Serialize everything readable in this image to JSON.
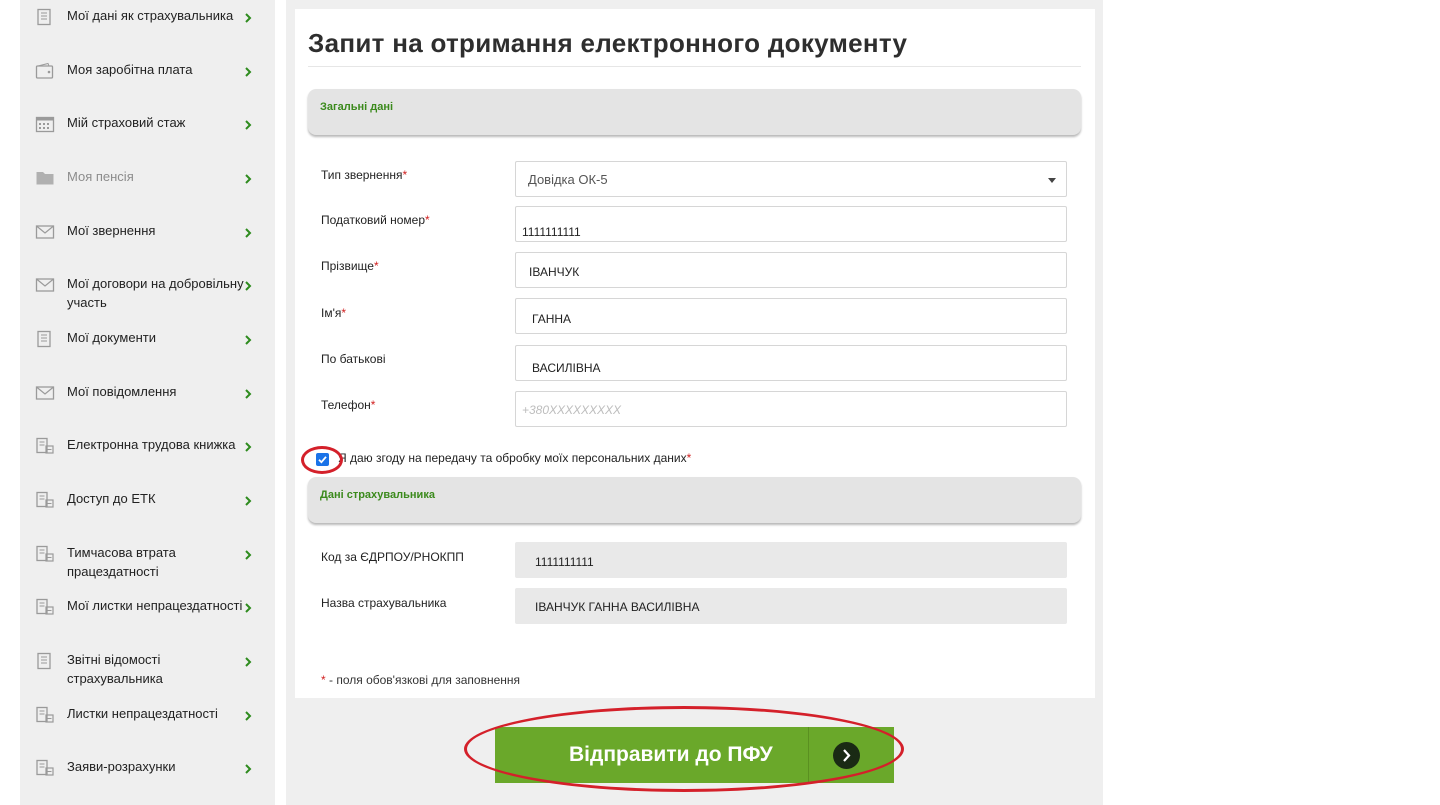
{
  "sidebar": {
    "items": [
      {
        "label": "Мої дані як страхувальника",
        "icon": "document-icon",
        "muted": false
      },
      {
        "label": "Моя заробітна плата",
        "icon": "wallet-icon",
        "muted": false
      },
      {
        "label": "Мій страховий стаж",
        "icon": "calendar-icon",
        "muted": false
      },
      {
        "label": "Моя пенсія",
        "icon": "folder-icon",
        "muted": true
      },
      {
        "label": "Мої звернення",
        "icon": "envelope-icon",
        "muted": false
      },
      {
        "label": "Мої договори на добровільну участь",
        "icon": "envelope-icon",
        "muted": false
      },
      {
        "label": "Мої документи",
        "icon": "document-icon",
        "muted": false
      },
      {
        "label": "Мої повідомлення",
        "icon": "envelope-icon",
        "muted": false
      },
      {
        "label": "Електронна трудова книжка",
        "icon": "book-icon",
        "muted": false
      },
      {
        "label": "Доступ до ЕТК",
        "icon": "book-icon",
        "muted": false
      },
      {
        "label": "Тимчасова втрата працездатності",
        "icon": "book-icon",
        "muted": false
      },
      {
        "label": "Мої листки непрацездатності",
        "icon": "book-icon",
        "muted": false
      },
      {
        "label": "Звітні відомості страхувальника",
        "icon": "document-icon",
        "muted": false
      },
      {
        "label": "Листки непрацездатності",
        "icon": "book-icon",
        "muted": false
      },
      {
        "label": "Заяви-розрахунки",
        "icon": "book-icon",
        "muted": false
      }
    ]
  },
  "form": {
    "title": "Запит на отримання електронного документу",
    "section_general": "Загальні дані",
    "section_insurer": "Дані страхувальника",
    "fields": {
      "request_type": {
        "label": "Тип звернення",
        "value": "Довідка ОК-5"
      },
      "tax_number": {
        "label": "Податковий номер",
        "value": "1111111111"
      },
      "surname": {
        "label": "Прізвище",
        "value": "ІВАНЧУК"
      },
      "name": {
        "label": "Ім'я",
        "value": "ГАННА"
      },
      "patronymic": {
        "label": "По батькові",
        "value": "ВАСИЛІВНА"
      },
      "phone": {
        "label": "Телефон",
        "placeholder": "+380XXXXXXXXX"
      },
      "edrpou": {
        "label": "Код за ЄДРПОУ/РНОКПП",
        "value": "1111111111"
      },
      "insurer_name": {
        "label": "Назва страхувальника",
        "value": "ІВАНЧУК ГАННА ВАСИЛІВНА"
      }
    },
    "required_mark": "*",
    "consent_text": "Я даю згоду на передачу та обробку моїх персональних даних",
    "consent_checked": true,
    "footnote": " - поля обов'язкові для заповнення",
    "submit_label": "Відправити до ПФУ"
  },
  "colors": {
    "accent_green": "#6aa82a",
    "section_green": "#3b8a1c",
    "annotation_red": "#d4202a",
    "required_red": "#d12020"
  }
}
